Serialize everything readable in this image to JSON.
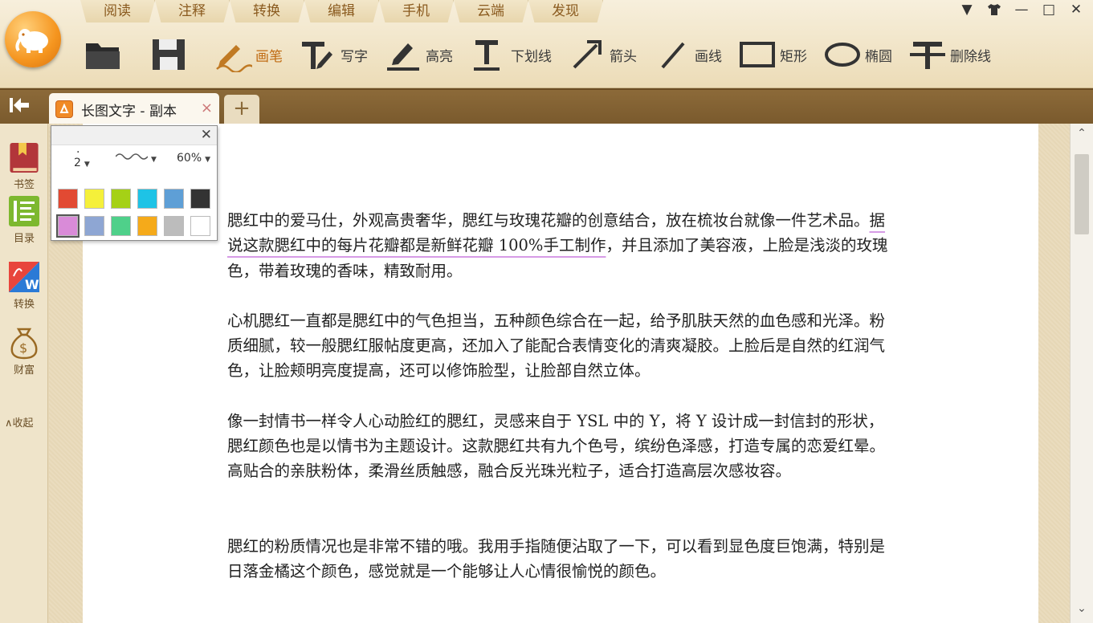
{
  "menu": [
    "阅读",
    "注释",
    "转换",
    "编辑",
    "手机",
    "云端",
    "发现"
  ],
  "toolbar": {
    "tools": [
      {
        "label": "画笔",
        "icon": "pen-icon",
        "active": true
      },
      {
        "label": "写字",
        "icon": "text-tool-icon"
      },
      {
        "label": "高亮",
        "icon": "highlight-icon"
      },
      {
        "label": "下划线",
        "icon": "underline-icon"
      },
      {
        "label": "箭头",
        "icon": "arrow-icon"
      },
      {
        "label": "画线",
        "icon": "line-icon"
      },
      {
        "label": "矩形",
        "icon": "rectangle-icon"
      },
      {
        "label": "椭圆",
        "icon": "ellipse-icon"
      },
      {
        "label": "删除线",
        "icon": "strikethrough-icon"
      }
    ]
  },
  "tab": {
    "title": "长图文字 - 副本",
    "close": "×",
    "add": "+"
  },
  "sidebar": {
    "items": [
      {
        "label": "书签",
        "icon": "bookmark-icon"
      },
      {
        "label": "目录",
        "icon": "toc-icon"
      },
      {
        "label": "转换",
        "icon": "pdf-to-word-icon"
      },
      {
        "label": "财富",
        "icon": "money-bag-icon"
      }
    ],
    "collapse": "∧收起"
  },
  "pen_panel": {
    "size_value": "2",
    "opacity_value": "60%",
    "colors": [
      "#e24a33",
      "#f5f03a",
      "#a5d116",
      "#1ec3e6",
      "#5e9fd6",
      "#333333",
      "#d98bd8",
      "#8ea6d3",
      "#4fd08a",
      "#f5aa1a",
      "#bcbcbc",
      "#ffffff"
    ],
    "selected_color_index": 6
  },
  "document": {
    "paragraphs": [
      {
        "before": "腮红中的爱马仕，外观高贵奢华，腮红与玫瑰花瓣的创意结合，放在梳妆台就像一件艺术品。",
        "highlight": "据说这款腮红中的每片花瓣都是新鲜花瓣 100%手工制作",
        "after": "，并且添加了美容液，上脸是浅淡的玫瑰色，带着玫瑰的香味，精致耐用。"
      },
      {
        "text": "心机腮红一直都是腮红中的气色担当，五种颜色综合在一起，给予肌肤天然的血色感和光泽。粉质细腻，较一般腮红服帖度更高，还加入了能配合表情变化的清爽凝胶。上脸后是自然的红润气色，让脸颊明亮度提高，还可以修饰脸型，让脸部自然立体。"
      },
      {
        "text": "像一封情书一样令人心动脸红的腮红，灵感来自于 YSL 中的 Y，将 Y 设计成一封信封的形状，腮红颜色也是以情书为主题设计。这款腮红共有九个色号，缤纷色泽感，打造专属的恋爱红晕。高贴合的亲肤粉体，柔滑丝质触感，融合反光珠光粒子，适合打造高层次感妆容。"
      },
      {
        "text": "腮红的粉质情况也是非常不错的哦。我用手指随便沾取了一下，可以看到显色度巨饱满，特别是日落金橘这个颜色，感觉就是一个能够让人心情很愉悦的颜色。"
      }
    ]
  }
}
